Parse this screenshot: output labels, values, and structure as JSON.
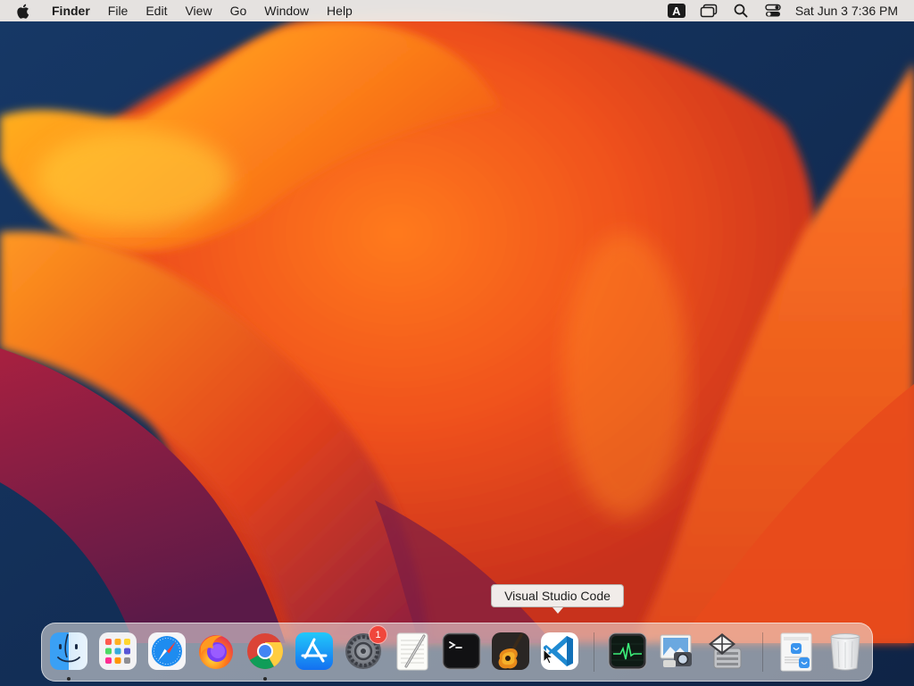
{
  "menubar": {
    "app_name": "Finder",
    "menus": [
      "File",
      "Edit",
      "View",
      "Go",
      "Window",
      "Help"
    ],
    "input_source": "A",
    "clock": "Sat Jun 3  7:36 PM",
    "icons": [
      "apple-logo-icon",
      "input-source-icon",
      "display-mirror-icon",
      "spotlight-icon",
      "control-center-icon"
    ]
  },
  "tooltip": {
    "text": "Visual Studio Code"
  },
  "dock": {
    "apps": [
      {
        "icon": "finder-icon",
        "running": true
      },
      {
        "icon": "launchpad-icon",
        "running": false
      },
      {
        "icon": "safari-icon",
        "running": false
      },
      {
        "icon": "firefox-icon",
        "running": false
      },
      {
        "icon": "chrome-icon",
        "running": true
      },
      {
        "icon": "app-store-icon",
        "running": false
      },
      {
        "icon": "system-settings-icon",
        "running": false,
        "badge": "1"
      },
      {
        "icon": "textedit-icon",
        "running": false
      },
      {
        "icon": "terminal-icon",
        "running": false
      },
      {
        "icon": "garageband-icon",
        "running": false
      },
      {
        "icon": "vscode-icon",
        "running": false
      },
      {
        "icon": "activity-monitor-icon",
        "running": false
      },
      {
        "icon": "preview-icon",
        "running": false
      },
      {
        "icon": "boot-camp-icon",
        "running": false
      },
      {
        "icon": "downloads-stack-icon",
        "running": false
      },
      {
        "icon": "trash-icon",
        "running": false
      }
    ]
  },
  "colors": {
    "accent": "#f26a1b",
    "wallpaper_blue": "#14305a",
    "badge": "#f0463c"
  }
}
